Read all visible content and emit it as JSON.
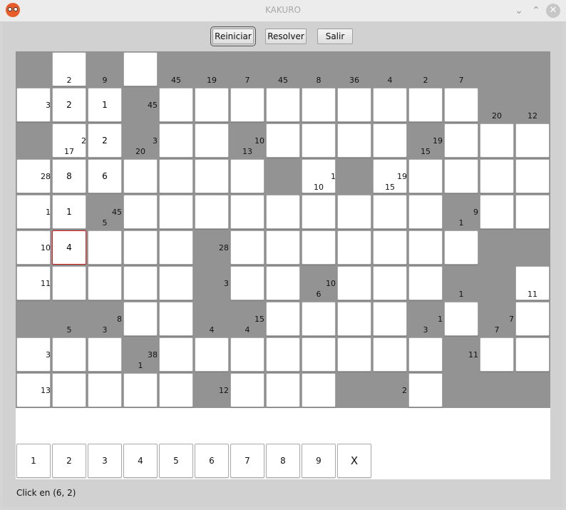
{
  "window": {
    "title": "KAKURO"
  },
  "toolbar": {
    "reiniciar": "Reiniciar",
    "resolver": "Resolver",
    "salir": "Salir"
  },
  "grid": {
    "rows": 10,
    "cols": 15,
    "blocked": [
      [
        1,
        0,
        1,
        0,
        1,
        1,
        1,
        1,
        1,
        1,
        1,
        1,
        1,
        1,
        1
      ],
      [
        0,
        0,
        0,
        1,
        0,
        0,
        0,
        0,
        0,
        0,
        0,
        0,
        0,
        1,
        1
      ],
      [
        1,
        0,
        0,
        1,
        0,
        0,
        1,
        0,
        0,
        0,
        0,
        1,
        0,
        0,
        0
      ],
      [
        0,
        0,
        0,
        0,
        0,
        0,
        0,
        1,
        0,
        1,
        0,
        0,
        0,
        0,
        0
      ],
      [
        0,
        0,
        1,
        0,
        0,
        0,
        0,
        0,
        0,
        0,
        0,
        0,
        1,
        0,
        0
      ],
      [
        0,
        0,
        0,
        0,
        0,
        1,
        0,
        0,
        0,
        0,
        0,
        0,
        0,
        1,
        1
      ],
      [
        0,
        0,
        0,
        0,
        0,
        1,
        0,
        0,
        1,
        0,
        0,
        0,
        1,
        1,
        0
      ],
      [
        1,
        1,
        1,
        0,
        0,
        1,
        1,
        0,
        0,
        0,
        0,
        1,
        0,
        1,
        0
      ],
      [
        0,
        0,
        0,
        1,
        0,
        0,
        0,
        0,
        0,
        0,
        0,
        0,
        1,
        0,
        0
      ],
      [
        0,
        0,
        0,
        0,
        0,
        1,
        0,
        0,
        0,
        1,
        1,
        0,
        1,
        1,
        1
      ]
    ],
    "values": [
      {
        "r": 1,
        "c": 1,
        "v": "2"
      },
      {
        "r": 1,
        "c": 2,
        "v": "1"
      },
      {
        "r": 2,
        "c": 2,
        "v": "2"
      },
      {
        "r": 3,
        "c": 1,
        "v": "8"
      },
      {
        "r": 3,
        "c": 2,
        "v": "6"
      },
      {
        "r": 4,
        "c": 1,
        "v": "1"
      },
      {
        "r": 5,
        "c": 1,
        "v": "4"
      }
    ],
    "selected": {
      "r": 5,
      "c": 1
    },
    "clues": [
      {
        "r": 0,
        "c": 1,
        "down": "2"
      },
      {
        "r": 0,
        "c": 2,
        "down": "9"
      },
      {
        "r": 0,
        "c": 4,
        "down": "45"
      },
      {
        "r": 0,
        "c": 5,
        "down": "19"
      },
      {
        "r": 0,
        "c": 6,
        "down": "7"
      },
      {
        "r": 0,
        "c": 7,
        "down": "45"
      },
      {
        "r": 0,
        "c": 8,
        "down": "8"
      },
      {
        "r": 0,
        "c": 9,
        "down": "36"
      },
      {
        "r": 0,
        "c": 10,
        "down": "4"
      },
      {
        "r": 0,
        "c": 11,
        "down": "2"
      },
      {
        "r": 0,
        "c": 12,
        "down": "7"
      },
      {
        "r": 1,
        "c": 0,
        "right": "3"
      },
      {
        "r": 1,
        "c": 3,
        "right": "45"
      },
      {
        "r": 1,
        "c": 13,
        "down": "20"
      },
      {
        "r": 1,
        "c": 14,
        "down": "12"
      },
      {
        "r": 2,
        "c": 1,
        "down": "17",
        "right": "2"
      },
      {
        "r": 2,
        "c": 3,
        "down": "20",
        "right": "3"
      },
      {
        "r": 2,
        "c": 6,
        "down": "13",
        "right": "10"
      },
      {
        "r": 2,
        "c": 11,
        "down": "15",
        "right": "19"
      },
      {
        "r": 3,
        "c": 0,
        "right": "28"
      },
      {
        "r": 3,
        "c": 8,
        "down": "10",
        "right": "1"
      },
      {
        "r": 3,
        "c": 10,
        "down": "15",
        "right": "19"
      },
      {
        "r": 4,
        "c": 0,
        "right": "1"
      },
      {
        "r": 4,
        "c": 2,
        "down": "5",
        "right": "45"
      },
      {
        "r": 4,
        "c": 12,
        "down": "1",
        "right": "9"
      },
      {
        "r": 5,
        "c": 0,
        "right": "10"
      },
      {
        "r": 5,
        "c": 5,
        "right": "28"
      },
      {
        "r": 6,
        "c": 0,
        "right": "11"
      },
      {
        "r": 6,
        "c": 5,
        "right": "3"
      },
      {
        "r": 6,
        "c": 8,
        "down": "6",
        "right": "10"
      },
      {
        "r": 6,
        "c": 12,
        "down": "1"
      },
      {
        "r": 6,
        "c": 14,
        "down": "11"
      },
      {
        "r": 7,
        "c": 1,
        "down": "5"
      },
      {
        "r": 7,
        "c": 2,
        "down": "3",
        "right": "8"
      },
      {
        "r": 7,
        "c": 5,
        "down": "4"
      },
      {
        "r": 7,
        "c": 6,
        "down": "4",
        "right": "15"
      },
      {
        "r": 7,
        "c": 11,
        "down": "3",
        "right": "1"
      },
      {
        "r": 7,
        "c": 13,
        "down": "7",
        "right": "7"
      },
      {
        "r": 8,
        "c": 0,
        "right": "3"
      },
      {
        "r": 8,
        "c": 3,
        "down": "1",
        "right": "38"
      },
      {
        "r": 8,
        "c": 12,
        "right": "11"
      },
      {
        "r": 9,
        "c": 0,
        "right": "13"
      },
      {
        "r": 9,
        "c": 5,
        "right": "12"
      },
      {
        "r": 9,
        "c": 10,
        "right": "2"
      }
    ]
  },
  "keypad": [
    "1",
    "2",
    "3",
    "4",
    "5",
    "6",
    "7",
    "8",
    "9",
    "X"
  ],
  "status": "Click en (6, 2)"
}
